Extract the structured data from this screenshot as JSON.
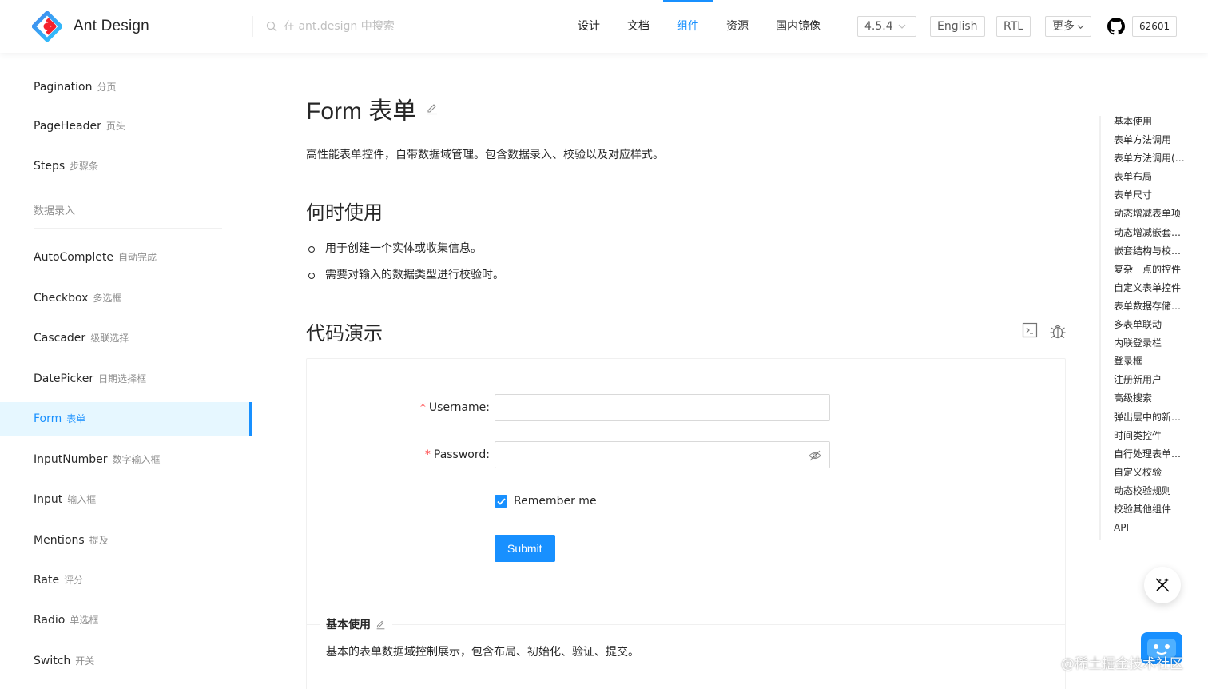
{
  "header": {
    "logo_text": "Ant Design",
    "search_placeholder": "在 ant.design 中搜索",
    "nav": [
      "设计",
      "文档",
      "组件",
      "资源",
      "国内镜像"
    ],
    "version": "4.5.4",
    "lang_button": "English",
    "direction_button": "RTL",
    "more_button": "更多",
    "github_stars": "62601"
  },
  "sidebar": {
    "partial_item": {
      "en": "Pagination",
      "zh": "分页"
    },
    "items_top": [
      {
        "en": "PageHeader",
        "zh": "页头"
      },
      {
        "en": "Steps",
        "zh": "步骤条"
      }
    ],
    "group_title": "数据录入",
    "items": [
      {
        "en": "AutoComplete",
        "zh": "自动完成"
      },
      {
        "en": "Checkbox",
        "zh": "多选框"
      },
      {
        "en": "Cascader",
        "zh": "级联选择"
      },
      {
        "en": "DatePicker",
        "zh": "日期选择框"
      },
      {
        "en": "Form",
        "zh": "表单"
      },
      {
        "en": "InputNumber",
        "zh": "数字输入框"
      },
      {
        "en": "Input",
        "zh": "输入框"
      },
      {
        "en": "Mentions",
        "zh": "提及"
      },
      {
        "en": "Rate",
        "zh": "评分"
      },
      {
        "en": "Radio",
        "zh": "单选框"
      },
      {
        "en": "Switch",
        "zh": "开关"
      }
    ]
  },
  "main": {
    "title": "Form 表单",
    "description": "高性能表单控件，自带数据域管理。包含数据录入、校验以及对应样式。",
    "when_title": "何时使用",
    "when_items": [
      "用于创建一个实体或收集信息。",
      "需要对输入的数据类型进行校验时。"
    ],
    "demo_title": "代码演示",
    "form": {
      "username_label": "Username",
      "password_label": "Password",
      "colon": ":",
      "required_mark": "*",
      "username_value": "",
      "password_value": "",
      "remember_label": "Remember me",
      "remember_checked": true,
      "submit_label": "Submit"
    },
    "demo_meta_title": "基本使用",
    "demo_meta_desc": "基本的表单数据域控制展示，包含布局、初始化、验证、提交。"
  },
  "anchor": [
    "基本使用",
    "表单方法调用",
    "表单方法调用(Class component)",
    "表单布局",
    "表单尺寸",
    "动态增减表单项",
    "动态增减嵌套字段",
    "嵌套结构与校验信息",
    "复杂一点的控件",
    "自定义表单控件",
    "表单数据存储于上层组件",
    "多表单联动",
    "内联登录栏",
    "登录框",
    "注册新用户",
    "高级搜索",
    "弹出层中的新建表单",
    "时间类控件",
    "自行处理表单数据",
    "自定义校验",
    "动态校验规则",
    "校验其他组件",
    "API"
  ],
  "watermark": "@稀土掘金技术社区",
  "colors": {
    "primary": "#1890ff",
    "required": "#ff4d4f"
  }
}
